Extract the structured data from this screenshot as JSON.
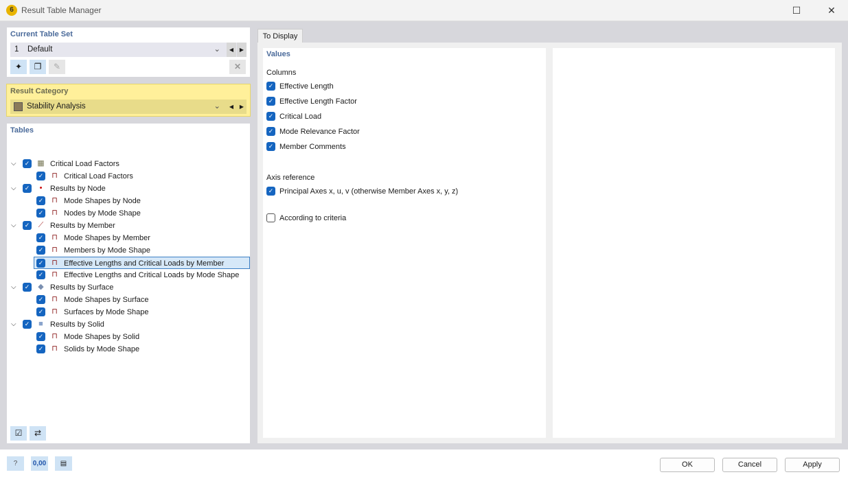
{
  "window": {
    "title": "Result Table Manager"
  },
  "table_set": {
    "header": "Current Table Set",
    "number": "1",
    "name": "Default"
  },
  "result_category": {
    "header": "Result Category",
    "value": "Stability Analysis",
    "accent": "#fff09a"
  },
  "tables": {
    "header": "Tables",
    "items": [
      {
        "level": 0,
        "label": "Critical Load Factors",
        "icon": "stability-icon",
        "checked": true
      },
      {
        "level": 1,
        "label": "Critical Load Factors",
        "icon": "table-icon",
        "checked": true
      },
      {
        "level": 0,
        "label": "Results by Node",
        "icon": "node-icon",
        "checked": true
      },
      {
        "level": 1,
        "label": "Mode Shapes by Node",
        "icon": "table-icon",
        "checked": true
      },
      {
        "level": 1,
        "label": "Nodes by Mode Shape",
        "icon": "table-icon",
        "checked": true
      },
      {
        "level": 0,
        "label": "Results by Member",
        "icon": "member-icon",
        "checked": true
      },
      {
        "level": 1,
        "label": "Mode Shapes by Member",
        "icon": "table-icon",
        "checked": true
      },
      {
        "level": 1,
        "label": "Members by Mode Shape",
        "icon": "table-icon",
        "checked": true
      },
      {
        "level": 1,
        "label": "Effective Lengths and Critical Loads by Member",
        "icon": "table-icon",
        "checked": true,
        "selected": true
      },
      {
        "level": 1,
        "label": "Effective Lengths and Critical Loads by Mode Shape",
        "icon": "table-icon",
        "checked": true
      },
      {
        "level": 0,
        "label": "Results by Surface",
        "icon": "surface-icon",
        "checked": true
      },
      {
        "level": 1,
        "label": "Mode Shapes by Surface",
        "icon": "table-icon",
        "checked": true
      },
      {
        "level": 1,
        "label": "Surfaces by Mode Shape",
        "icon": "table-icon",
        "checked": true
      },
      {
        "level": 0,
        "label": "Results by Solid",
        "icon": "solid-icon",
        "checked": true
      },
      {
        "level": 1,
        "label": "Mode Shapes by Solid",
        "icon": "table-icon",
        "checked": true
      },
      {
        "level": 1,
        "label": "Solids by Mode Shape",
        "icon": "table-icon",
        "checked": true
      }
    ]
  },
  "tab": {
    "label": "To Display"
  },
  "values": {
    "header": "Values",
    "columns_label": "Columns",
    "columns": [
      {
        "label": "Effective Length",
        "checked": true
      },
      {
        "label": "Effective Length Factor",
        "checked": true
      },
      {
        "label": "Critical Load",
        "checked": true
      },
      {
        "label": "Mode Relevance Factor",
        "checked": true
      },
      {
        "label": "Member Comments",
        "checked": true
      }
    ],
    "axis_label": "Axis reference",
    "axis_option": {
      "label": "Principal Axes x, u, v (otherwise Member Axes x, y, z)",
      "checked": true
    },
    "criteria_option": {
      "label": "According to criteria",
      "checked": false
    }
  },
  "footer": {
    "ok": "OK",
    "cancel": "Cancel",
    "apply": "Apply",
    "decimals_icon_text": "0,00"
  }
}
